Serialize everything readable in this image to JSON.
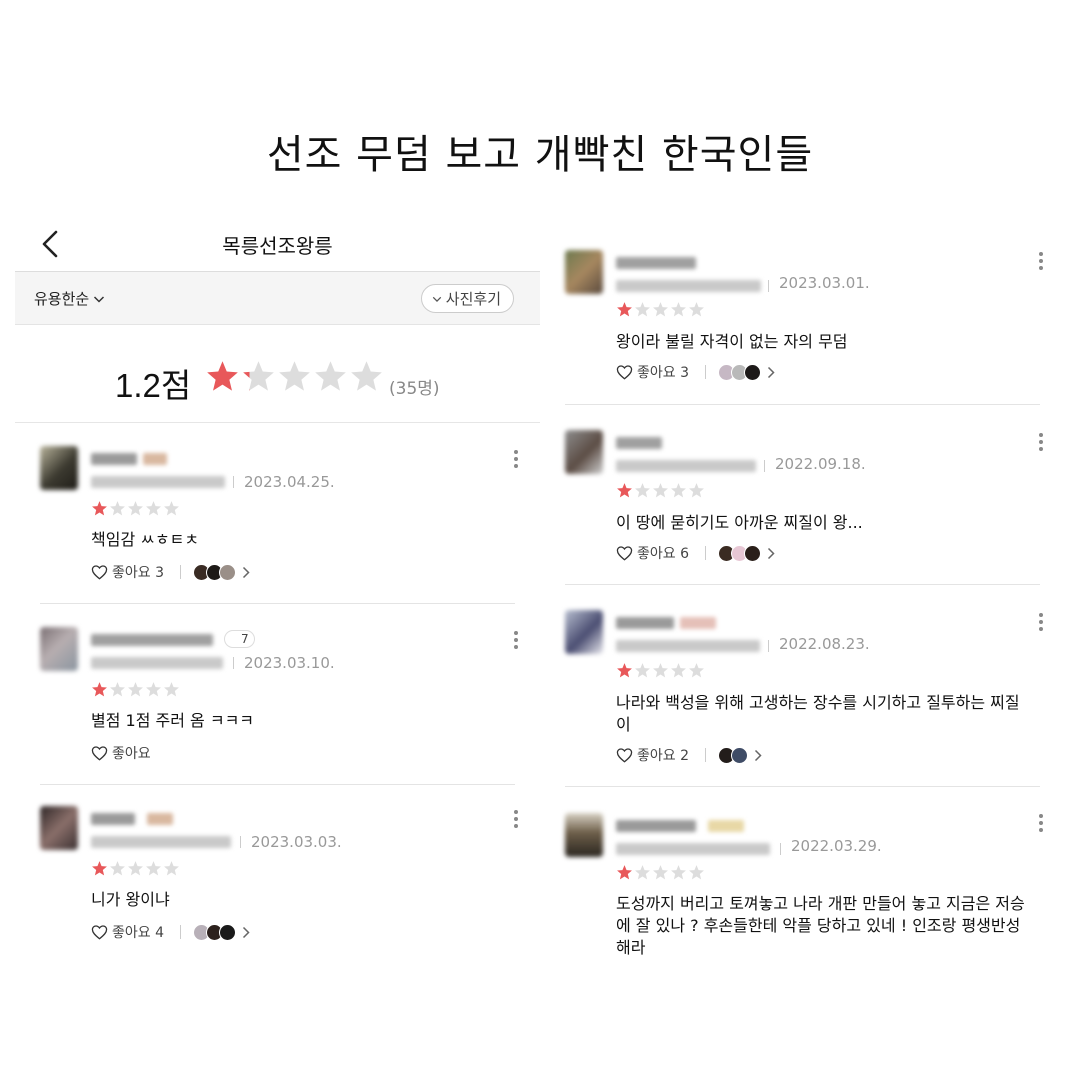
{
  "page_title": "선조 무덤 보고 개빡친 한국인들",
  "left_panel": {
    "header": {
      "title": "목릉선조왕릉",
      "back_icon": "chevron-left-icon"
    },
    "filter": {
      "sort_label": "유용한순",
      "photo_review_label": "사진후기"
    },
    "summary": {
      "score": "1.2점",
      "rating": 1.2,
      "count": "(35명)"
    },
    "badge": "7",
    "reviews": [
      {
        "date": "2023.04.25.",
        "stars": 1,
        "text": "책임감 ㅆㅎㅌㅊ",
        "like_label": "좋아요 3"
      },
      {
        "date": "2023.03.10.",
        "stars": 1,
        "text": "별점 1점 주러 옴 ㅋㅋㅋ",
        "like_label": "좋아요"
      },
      {
        "date": "2023.03.03.",
        "stars": 1,
        "text": "니가 왕이냐",
        "like_label": "좋아요 4"
      }
    ]
  },
  "right_panel": {
    "reviews": [
      {
        "date": "2023.03.01.",
        "stars": 1,
        "text": "왕이라 불릴 자격이 없는 자의 무덤",
        "like_label": "좋아요 3"
      },
      {
        "date": "2022.09.18.",
        "stars": 1,
        "text": "이 땅에 묻히기도 아까운 찌질이 왕...",
        "like_label": "좋아요 6"
      },
      {
        "date": "2022.08.23.",
        "stars": 1,
        "text_lines": [
          "나라와 백성을 위해 고생하는 장수를 시기하고 질투하는 찌질",
          "이"
        ],
        "like_label": "좋아요 2"
      },
      {
        "date": "2022.03.29.",
        "stars": 1,
        "text_lines": [
          "도성까지 버리고 토껴놓고 나라 개판 만들어 놓고 지금은 저승",
          "에 잘 있나 ?  후손들한테 악플 당하고 있네 ! 인조랑 평생반성",
          "해라"
        ]
      }
    ]
  },
  "colors": {
    "star_active": "#e8585a",
    "star_inactive": "#dddddd",
    "date": "#999999",
    "divider": "#e4e4e4"
  },
  "icons": [
    "chevron-left-icon",
    "chevron-down-icon",
    "star-icon",
    "heart-icon",
    "more-vertical-icon",
    "chevron-right-icon"
  ]
}
